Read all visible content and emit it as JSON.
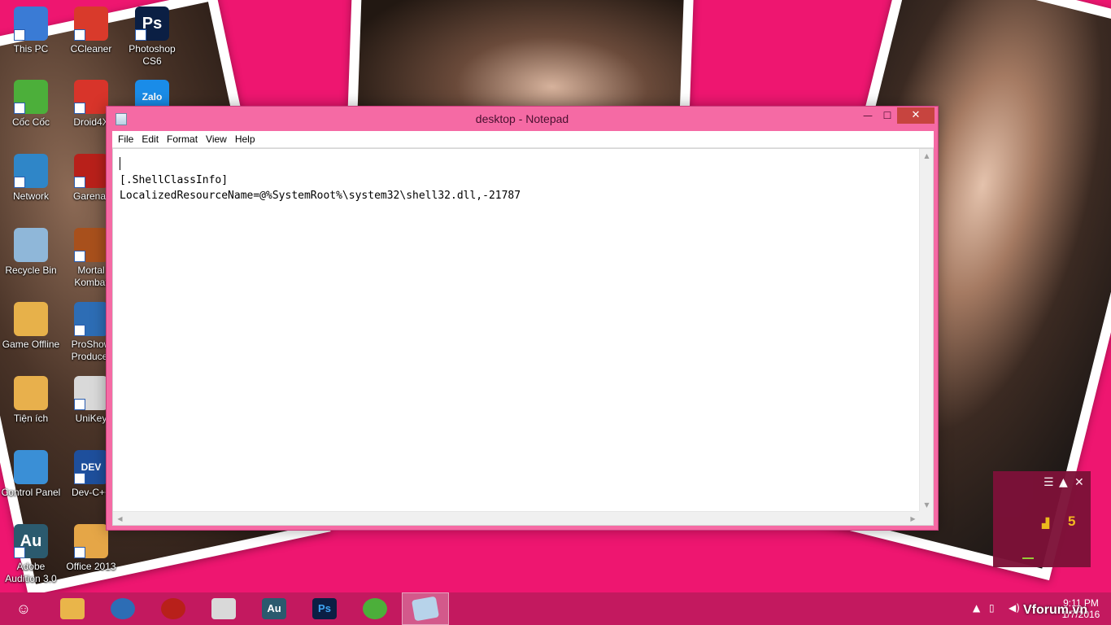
{
  "desktop": {
    "icons": [
      {
        "label": "This PC",
        "glyph": "",
        "color": "#3a7bd5"
      },
      {
        "label": "CCleaner",
        "glyph": "",
        "color": "#d93a2b"
      },
      {
        "label": "Photoshop CS6",
        "glyph": "Ps",
        "color": "#0b1f44"
      },
      {
        "label": "Cốc Cốc",
        "glyph": "",
        "color": "#4caf3a"
      },
      {
        "label": "Droid4X",
        "glyph": "",
        "color": "#d8342a"
      },
      {
        "label": "Zalo",
        "glyph": "Zalo",
        "color": "#1a8ce8"
      },
      {
        "label": "Network",
        "glyph": "",
        "color": "#2f86c8"
      },
      {
        "label": "Garena-",
        "glyph": "",
        "color": "#b8201a"
      },
      {
        "label": "Recycle Bin",
        "glyph": "",
        "color": "#8fb7d9"
      },
      {
        "label": "Mortal Kombat",
        "glyph": "",
        "color": "#a8501c"
      },
      {
        "label": "Game Offline",
        "glyph": "",
        "color": "#e7b14a"
      },
      {
        "label": "ProShow Producer",
        "glyph": "",
        "color": "#2d6db5"
      },
      {
        "label": "Tiện ích",
        "glyph": "",
        "color": "#e8b04c"
      },
      {
        "label": "UniKey",
        "glyph": "",
        "color": "#d9d9d9"
      },
      {
        "label": "Control Panel",
        "glyph": "",
        "color": "#3a8fd6"
      },
      {
        "label": "Dev-C++",
        "glyph": "DEV",
        "color": "#1e4f9c"
      },
      {
        "label": "Adobe Audition 3.0",
        "glyph": "Au",
        "color": "#2b5a6e"
      },
      {
        "label": "Office 2013",
        "glyph": "",
        "color": "#e5a647"
      }
    ]
  },
  "notepad": {
    "title": "desktop - Notepad",
    "menu": [
      "File",
      "Edit",
      "Format",
      "View",
      "Help"
    ],
    "content": {
      "line1": "[.ShellClassInfo]",
      "line2": "LocalizedResourceName=@%SystemRoot%\\system32\\shell32.dll,-21787"
    }
  },
  "widget": {
    "count": "5"
  },
  "taskbar": {
    "apps": [
      {
        "name": "anonymous-mask",
        "glyph": "",
        "color": "#ffffff",
        "active": false
      },
      {
        "name": "file-explorer",
        "glyph": "",
        "color": "#e9b54a",
        "active": false
      },
      {
        "name": "proshow-producer",
        "glyph": "",
        "color": "#2d6db5",
        "active": false
      },
      {
        "name": "garena",
        "glyph": "",
        "color": "#b8201a",
        "active": false
      },
      {
        "name": "unikey",
        "glyph": "",
        "color": "#d9d9d9",
        "active": false
      },
      {
        "name": "adobe-audition",
        "glyph": "Au",
        "color": "#2b5a6e",
        "active": false
      },
      {
        "name": "photoshop",
        "glyph": "Ps",
        "color": "#0b1f44",
        "active": false
      },
      {
        "name": "coc-coc",
        "glyph": "",
        "color": "#4caf3a",
        "active": false
      },
      {
        "name": "notepad",
        "glyph": "",
        "color": "#b7d3ea",
        "active": true
      }
    ],
    "clock_time": "9:11 PM",
    "clock_date": "1/7/2016",
    "watermark": "Vforum.vn"
  },
  "colors": {
    "accent": "#f56aa4",
    "taskbar": "#c3195f",
    "close": "#c7443f"
  }
}
